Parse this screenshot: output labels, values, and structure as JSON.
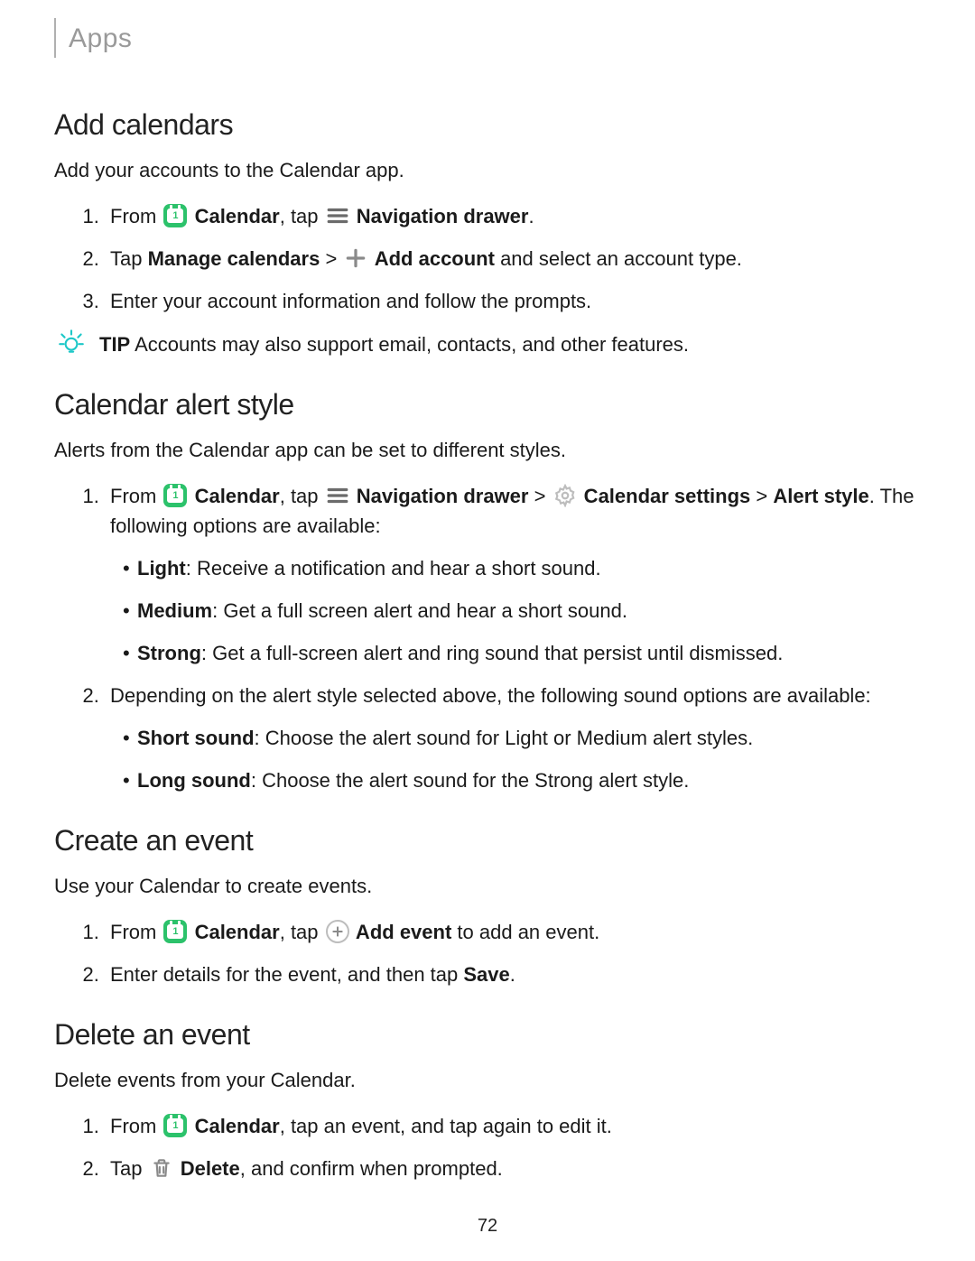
{
  "breadcrumb": "Apps",
  "page_number": "72",
  "sections": {
    "add_calendars": {
      "heading": "Add calendars",
      "intro": "Add your accounts to the Calendar app.",
      "step1_a": "From ",
      "step1_b": " Calendar",
      "step1_c": ", tap ",
      "step1_d": " Navigation drawer",
      "step1_e": ".",
      "step2_a": "Tap ",
      "step2_b": "Manage calendars",
      "step2_c": " > ",
      "step2_d": " Add account",
      "step2_e": " and select an account type.",
      "step3": "Enter your account information and follow the prompts."
    },
    "tip": {
      "label": "TIP",
      "text": "  Accounts may also support email, contacts, and other features."
    },
    "alert_style": {
      "heading": "Calendar alert style",
      "intro": "Alerts from the Calendar app can be set to different styles.",
      "s1_a": "From ",
      "s1_b": " Calendar",
      "s1_c": ", tap ",
      "s1_d": " Navigation drawer",
      "s1_e": " > ",
      "s1_f": " Calendar settings",
      "s1_g": " > ",
      "s1_h": "Alert style",
      "s1_i": ". The following options are available:",
      "opt_light_b": "Light",
      "opt_light": ": Receive a notification and hear a short sound.",
      "opt_medium_b": "Medium",
      "opt_medium": ": Get a full screen alert and hear a short sound.",
      "opt_strong_b": "Strong",
      "opt_strong": ": Get a full-screen alert and ring sound that persist until dismissed.",
      "s2": "Depending on the alert style selected above, the following sound options are available:",
      "opt_short_b": "Short sound",
      "opt_short": ": Choose the alert sound for Light or Medium alert styles.",
      "opt_long_b": "Long sound",
      "opt_long": ": Choose the alert sound for the Strong alert style."
    },
    "create_event": {
      "heading": "Create an event",
      "intro": "Use your Calendar to create events.",
      "s1_a": "From ",
      "s1_b": " Calendar",
      "s1_c": ", tap ",
      "s1_d": " Add event",
      "s1_e": " to add an event.",
      "s2_a": "Enter details for the event, and then tap ",
      "s2_b": "Save",
      "s2_c": "."
    },
    "delete_event": {
      "heading": "Delete an event",
      "intro": "Delete events from your Calendar.",
      "s1_a": "From ",
      "s1_b": " Calendar",
      "s1_c": ", tap an event, and tap again to edit it.",
      "s2_a": "Tap ",
      "s2_b": " Delete",
      "s2_c": ", and confirm when prompted."
    }
  }
}
